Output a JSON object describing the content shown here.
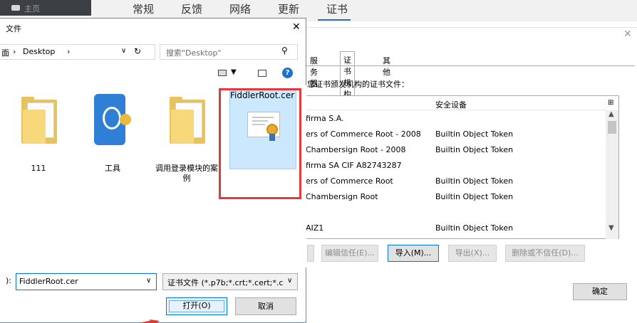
{
  "top_bar": {
    "sidebar_text": "主页",
    "tabs": [
      "常规",
      "反馈",
      "网络",
      "更新",
      "证书"
    ],
    "active_tab": "证书"
  },
  "cert_manager": {
    "tabs": [
      "服务器",
      "证书机构",
      "其他"
    ],
    "active_tab": "证书机构",
    "intended_text": "您证书颁发机构的证书文件：",
    "column_security_device": "安全设备",
    "rows": [
      {
        "name": "firma S.A.",
        "device": ""
      },
      {
        "name": "ers of Commerce Root - 2008",
        "device": "Builtin Object Token"
      },
      {
        "name": "Chambersign Root - 2008",
        "device": "Builtin Object Token"
      },
      {
        "name": "firma SA CIF A82743287",
        "device": ""
      },
      {
        "name": "ers of Commerce Root",
        "device": "Builtin Object Token"
      },
      {
        "name": "Chambersign Root",
        "device": "Builtin Object Token"
      },
      {
        "name": "",
        "device": ""
      },
      {
        "name": "AIZ1",
        "device": "Builtin Object Token"
      }
    ],
    "buttons": {
      "edit_trust": "编辑信任(E)...",
      "import": "导入(M)...",
      "export": "导出(X)...",
      "delete_distrust": "删除或不信任(D)..."
    },
    "ok": "确定"
  },
  "file_picker": {
    "title": "文件",
    "close": "✕",
    "address": {
      "prefix": "面",
      "sep": "›",
      "location": "Desktop",
      "sep2": "›"
    },
    "search_placeholder": "搜索\"Desktop\"",
    "files": [
      {
        "label": "111"
      },
      {
        "label": "工具"
      },
      {
        "label": "调用登录模块的案例"
      },
      {
        "label": "FiddlerRoot.cer"
      }
    ],
    "filename_label": "):",
    "filename_value": "FiddlerRoot.cer",
    "filetype_value": "证书文件 (*.p7b;*.crt;*.cert;*.c",
    "open_button": "打开(O)",
    "cancel_button": "取消"
  },
  "colors": {
    "accent": "#0078d7",
    "highlight_box": "#e03a3a",
    "selection": "#cce8ff"
  }
}
